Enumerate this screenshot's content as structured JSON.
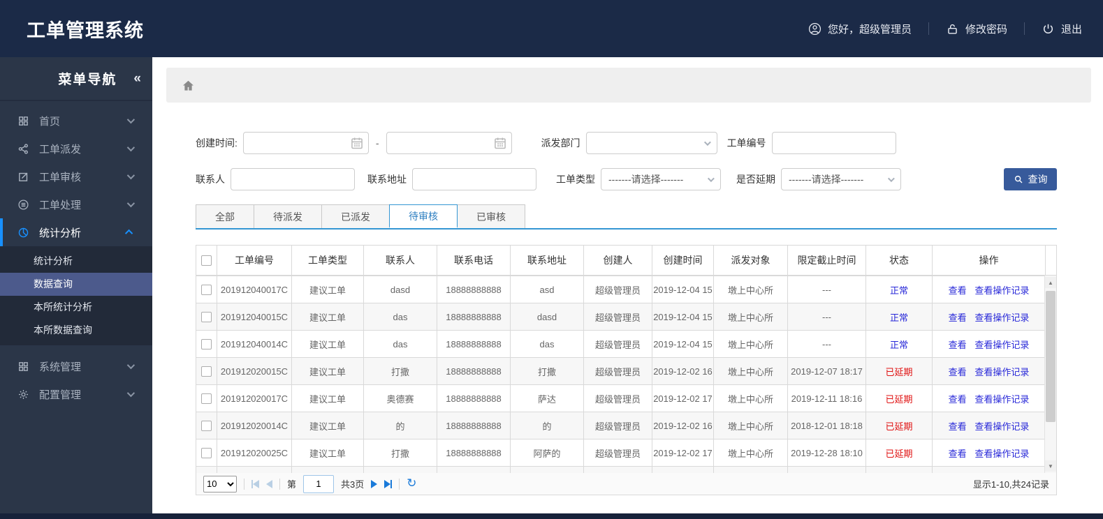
{
  "header": {
    "title": "工单管理系统",
    "greeting": "您好，超级管理员",
    "change_password": "修改密码",
    "logout": "退出"
  },
  "sidebar": {
    "title": "菜单导航",
    "collapse_icon": "«",
    "items": [
      {
        "label": "首页",
        "icon": "grid-icon"
      },
      {
        "label": "工单派发",
        "icon": "share-icon"
      },
      {
        "label": "工单审核",
        "icon": "edit-icon"
      },
      {
        "label": "工单处理",
        "icon": "process-icon"
      },
      {
        "label": "统计分析",
        "icon": "pie-chart-icon",
        "active": true,
        "children": [
          {
            "label": "统计分析"
          },
          {
            "label": "数据查询",
            "selected": true
          },
          {
            "label": "本所统计分析"
          },
          {
            "label": "本所数据查询"
          }
        ]
      },
      {
        "label": "系统管理",
        "icon": "grid-icon"
      },
      {
        "label": "配置管理",
        "icon": "gear-icon"
      }
    ]
  },
  "filters": {
    "create_time_label": "创建时间:",
    "date_start_value": "",
    "date_separator": "-",
    "date_end_value": "",
    "dispatch_dept_label": "派发部门",
    "dispatch_dept_value": "",
    "order_no_label": "工单编号",
    "order_no_value": "",
    "contact_label": "联系人",
    "contact_value": "",
    "address_label": "联系地址",
    "address_value": "",
    "order_type_label": "工单类型",
    "order_type_value": "-------请选择-------",
    "delay_label": "是否延期",
    "delay_value": "-------请选择-------",
    "query_button": "查询"
  },
  "tabs": [
    {
      "label": "全部"
    },
    {
      "label": "待派发"
    },
    {
      "label": "已派发"
    },
    {
      "label": "待审核",
      "active": true
    },
    {
      "label": "已审核"
    }
  ],
  "table": {
    "columns": [
      "工单编号",
      "工单类型",
      "联系人",
      "联系电话",
      "联系地址",
      "创建人",
      "创建时间",
      "派发对象",
      "限定截止时间",
      "状态",
      "操作"
    ],
    "rows": [
      {
        "order_no": "201912040017C",
        "order_type": "建议工单",
        "contact": "dasd",
        "phone": "18888888888",
        "address": "asd",
        "creator": "超级管理员",
        "create_time": "2019-12-04 15",
        "dispatch_target": "墩上中心所",
        "deadline": "---",
        "status": "正常",
        "status_type": "normal",
        "view": "查看",
        "view_log": "查看操作记录"
      },
      {
        "order_no": "201912040015C",
        "order_type": "建议工单",
        "contact": "das",
        "phone": "18888888888",
        "address": "dasd",
        "creator": "超级管理员",
        "create_time": "2019-12-04 15",
        "dispatch_target": "墩上中心所",
        "deadline": "---",
        "status": "正常",
        "status_type": "normal",
        "view": "查看",
        "view_log": "查看操作记录"
      },
      {
        "order_no": "201912040014C",
        "order_type": "建议工单",
        "contact": "das",
        "phone": "18888888888",
        "address": "das",
        "creator": "超级管理员",
        "create_time": "2019-12-04 15",
        "dispatch_target": "墩上中心所",
        "deadline": "---",
        "status": "正常",
        "status_type": "normal",
        "view": "查看",
        "view_log": "查看操作记录"
      },
      {
        "order_no": "201912020015C",
        "order_type": "建议工单",
        "contact": "打撒",
        "phone": "18888888888",
        "address": "打撒",
        "creator": "超级管理员",
        "create_time": "2019-12-02 16",
        "dispatch_target": "墩上中心所",
        "deadline": "2019-12-07 18:17",
        "status": "已延期",
        "status_type": "delayed",
        "view": "查看",
        "view_log": "查看操作记录"
      },
      {
        "order_no": "201912020017C",
        "order_type": "建议工单",
        "contact": "奥德赛",
        "phone": "18888888888",
        "address": "萨达",
        "creator": "超级管理员",
        "create_time": "2019-12-02 17",
        "dispatch_target": "墩上中心所",
        "deadline": "2019-12-11 18:16",
        "status": "已延期",
        "status_type": "delayed",
        "view": "查看",
        "view_log": "查看操作记录"
      },
      {
        "order_no": "201912020014C",
        "order_type": "建议工单",
        "contact": "的",
        "phone": "18888888888",
        "address": "的",
        "creator": "超级管理员",
        "create_time": "2019-12-02 16",
        "dispatch_target": "墩上中心所",
        "deadline": "2018-12-01 18:18",
        "status": "已延期",
        "status_type": "delayed",
        "view": "查看",
        "view_log": "查看操作记录"
      },
      {
        "order_no": "201912020025C",
        "order_type": "建议工单",
        "contact": "打撒",
        "phone": "18888888888",
        "address": "阿萨的",
        "creator": "超级管理员",
        "create_time": "2019-12-02 17",
        "dispatch_target": "墩上中心所",
        "deadline": "2019-12-28 18:10",
        "status": "已延期",
        "status_type": "delayed",
        "view": "查看",
        "view_log": "查看操作记录"
      },
      {
        "order_no": "",
        "order_type": "",
        "contact": "",
        "phone": "",
        "address": "",
        "creator": "",
        "create_time": "",
        "dispatch_target": "",
        "deadline": "",
        "status": "",
        "status_type": "",
        "view": "",
        "view_log": ""
      }
    ]
  },
  "pagination": {
    "page_size": "10",
    "page_label_prefix": "第",
    "current_page": "1",
    "total_pages_label": "共3页",
    "refresh_icon": "↻",
    "summary": "显示1-10,共24记录"
  },
  "colors": {
    "header_bg": "#1b2a47",
    "sidebar_bg": "#2b3648",
    "accent_blue": "#1890ff",
    "submenu_selected_bg": "#4c5a8c",
    "tab_active_blue": "#3496d3",
    "link_blue": "#2727d8",
    "status_delayed_red": "#e01111",
    "query_button_bg": "#375a9b"
  }
}
